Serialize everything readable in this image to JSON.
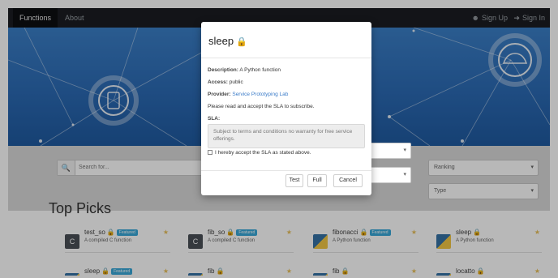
{
  "nav": {
    "functions": "Functions",
    "about": "About",
    "signup": "Sign Up",
    "signin": "Sign In"
  },
  "filters": {
    "search_placeholder": "Search for...",
    "ranking": "Ranking",
    "type": "Type"
  },
  "main": {
    "top_picks_title": "Top Picks",
    "cards": [
      {
        "name": "test_so",
        "badge": "Featured",
        "desc": "A compiled C function"
      },
      {
        "name": "fib_so",
        "badge": "Featured",
        "desc": "A compiled C function"
      },
      {
        "name": "fibonacci",
        "badge": "Featured",
        "desc": "A Python function"
      },
      {
        "name": "sleep",
        "badge": "",
        "desc": "A Python function"
      },
      {
        "name": "sleep",
        "badge": "Featured",
        "desc": ""
      },
      {
        "name": "fib",
        "badge": "",
        "desc": ""
      },
      {
        "name": "fib",
        "badge": "",
        "desc": ""
      },
      {
        "name": "locatto",
        "badge": "",
        "desc": ""
      }
    ]
  },
  "modal": {
    "title": "sleep",
    "description_label": "Description:",
    "description_value": "A Python function",
    "access_label": "Access:",
    "access_value": "public",
    "provider_label": "Provider:",
    "provider_value": "Service Prototyping Lab",
    "sla_notice": "Please read and accept the SLA to subscribe.",
    "sla_label": "SLA:",
    "sla_text": "Subject to terms and conditions no warranty for free service offerings.",
    "agree_label": "I hereby accept the SLA as stated above.",
    "btn_test": "Test",
    "btn_full": "Full",
    "btn_cancel": "Cancel"
  },
  "colors": {
    "navbar": "#1b1d22",
    "hero": "#2b6ab4",
    "link": "#3a7bc8",
    "badge": "#3aa8d8",
    "lock": "#e6b325"
  }
}
